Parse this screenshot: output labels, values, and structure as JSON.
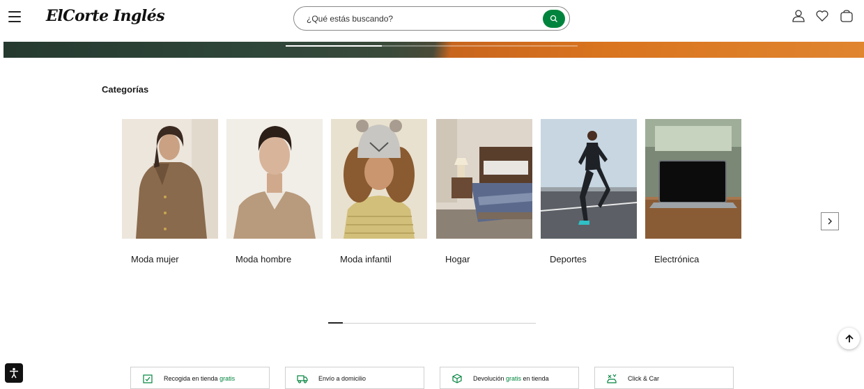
{
  "header": {
    "logo_text": "ElCorte Inglés",
    "search_placeholder": "¿Qué estás buscando?",
    "icons": [
      "menu-icon",
      "search-icon",
      "user-icon",
      "heart-icon",
      "bag-icon"
    ]
  },
  "banner": {
    "progress_fraction": 0.33
  },
  "categories": {
    "title": "Categorías",
    "items": [
      {
        "label": "Moda mujer"
      },
      {
        "label": "Moda hombre"
      },
      {
        "label": "Moda infantil"
      },
      {
        "label": "Hogar"
      },
      {
        "label": "Deportes"
      },
      {
        "label": "Electrónica"
      }
    ],
    "scroll_fraction": 0.07
  },
  "services": [
    {
      "text": "Recogida en tienda ",
      "highlight": "gratis",
      "suffix": "",
      "icon": "store-pickup-icon"
    },
    {
      "text": "Envío a domicilio",
      "highlight": "",
      "suffix": "",
      "icon": "delivery-truck-icon"
    },
    {
      "text": "Devolución ",
      "highlight": "gratis",
      "suffix": " en tienda",
      "icon": "return-box-icon"
    },
    {
      "text": "Click & Car",
      "highlight": "",
      "suffix": "",
      "icon": "click-car-icon"
    }
  ],
  "colors": {
    "brand_green": "#00843d"
  }
}
